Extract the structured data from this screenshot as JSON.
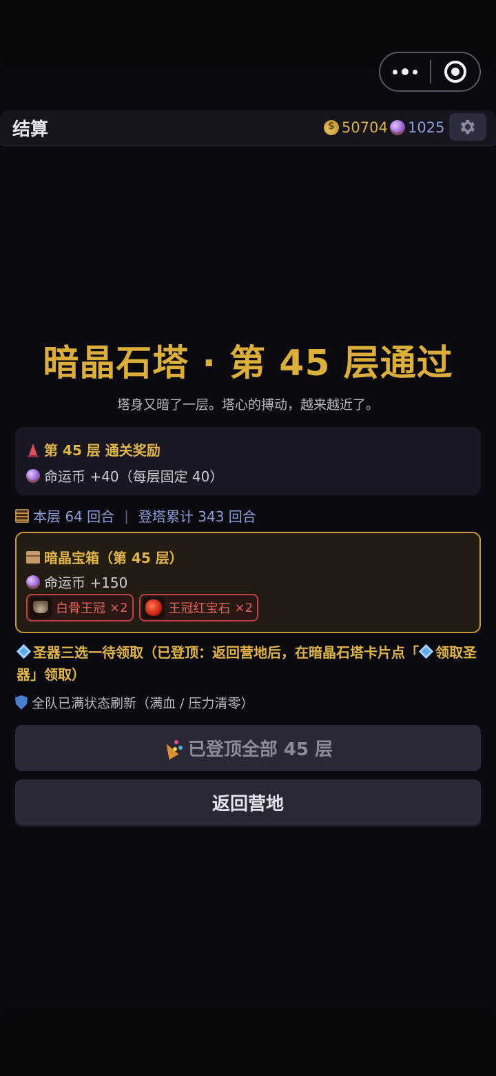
{
  "header": {
    "title": "结算",
    "gold": "50704",
    "fate": "1025",
    "gold_icon": "money-bag-icon",
    "fate_icon": "crystal-ball-icon",
    "settings_icon": "gear-icon"
  },
  "result": {
    "headline": "暗晶石塔 · 第 45 层通过",
    "subtitle": "塔身又暗了一层。塔心的搏动，越来越近了。"
  },
  "floor_reward": {
    "title": "第 45 层 通关奖励",
    "line": "命运币 +40（每层固定 40）"
  },
  "turns": {
    "floor": "本层 64 回合",
    "total": "登塔累计 343 回合"
  },
  "chest": {
    "title": "暗晶宝箱（第 45 层）",
    "fate": "命运币 +150",
    "items": [
      {
        "name": "白骨王冠",
        "count": "×2",
        "icon": "bone-crown-icon"
      },
      {
        "name": "王冠红宝石",
        "count": "×2",
        "icon": "crown-ruby-icon"
      }
    ]
  },
  "notices": {
    "artifact_a": "圣器三选一待领取（已登顶：返回营地后，在暗晶石塔卡片点「",
    "artifact_b": "领取圣器」领取）",
    "refresh": "全队已满状态刷新（满血 / 压力清零）"
  },
  "buttons": {
    "summit": "已登顶全部 45 层",
    "return": "返回营地"
  },
  "colors": {
    "accent_gold": "#dcae3c",
    "fate_blue": "#8d9cd6",
    "item_red": "#e4605c"
  }
}
